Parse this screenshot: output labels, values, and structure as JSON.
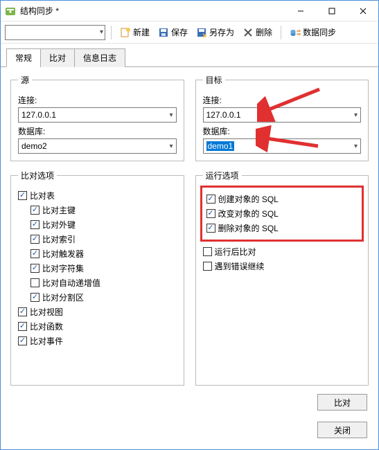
{
  "window": {
    "title": "结构同步 *"
  },
  "toolbar": {
    "new": "新建",
    "save": "保存",
    "saveAs": "另存为",
    "delete": "删除",
    "dataSync": "数据同步"
  },
  "tabs": {
    "general": "常规",
    "compare": "比对",
    "log": "信息日志"
  },
  "source": {
    "legend": "源",
    "connLabel": "连接:",
    "conn": "127.0.0.1",
    "dbLabel": "数据库:",
    "db": "demo2"
  },
  "target": {
    "legend": "目标",
    "connLabel": "连接:",
    "conn": "127.0.0.1",
    "dbLabel": "数据库:",
    "db": "demo1"
  },
  "compareOptions": {
    "legend": "比对选项",
    "items": {
      "compareTable": "比对表",
      "comparePK": "比对主键",
      "compareFK": "比对外键",
      "compareIndex": "比对索引",
      "compareTrigger": "比对触发器",
      "compareCharset": "比对字符集",
      "compareAutoInc": "比对自动递增值",
      "comparePartition": "比对分割区",
      "compareView": "比对视图",
      "compareFunction": "比对函数",
      "compareEvent": "比对事件"
    }
  },
  "runOptions": {
    "legend": "运行选项",
    "items": {
      "sqlCreate": "创建对象的 SQL",
      "sqlAlter": "改变对象的 SQL",
      "sqlDrop": "删除对象的 SQL",
      "runAfterCompare": "运行后比对",
      "continueOnError": "遇到错误继续"
    }
  },
  "buttons": {
    "compare": "比对",
    "close": "关闭"
  },
  "colors": {
    "accent": "#0078d7",
    "hlBorder": "#e03030"
  }
}
